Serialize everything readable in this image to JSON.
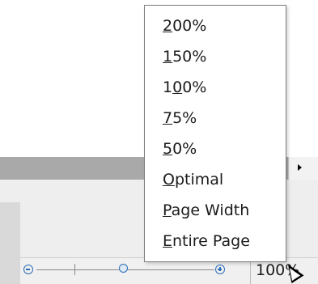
{
  "zoom_menu": {
    "items": [
      {
        "mnemonic": "2",
        "rest": "00%"
      },
      {
        "mnemonic": "1",
        "rest": "50%"
      },
      {
        "pre": "1",
        "mnemonic": "0",
        "rest": "0%"
      },
      {
        "mnemonic": "7",
        "rest": "5%"
      },
      {
        "mnemonic": "5",
        "rest": "0%"
      },
      {
        "mnemonic": "O",
        "rest": "ptimal"
      },
      {
        "mnemonic": "P",
        "rest": "age Width"
      },
      {
        "mnemonic": "E",
        "rest": "ntire Page"
      }
    ]
  },
  "statusbar": {
    "zoom_value": "100%",
    "zoom_level_percent": 100
  },
  "icons": {
    "zoom_out": "minus-circle-icon",
    "zoom_in": "plus-circle-icon",
    "scroll_right": "triangle-right-icon"
  },
  "colors": {
    "accent": "#2a6fb8",
    "ruler_gray": "#a9a9a9"
  }
}
